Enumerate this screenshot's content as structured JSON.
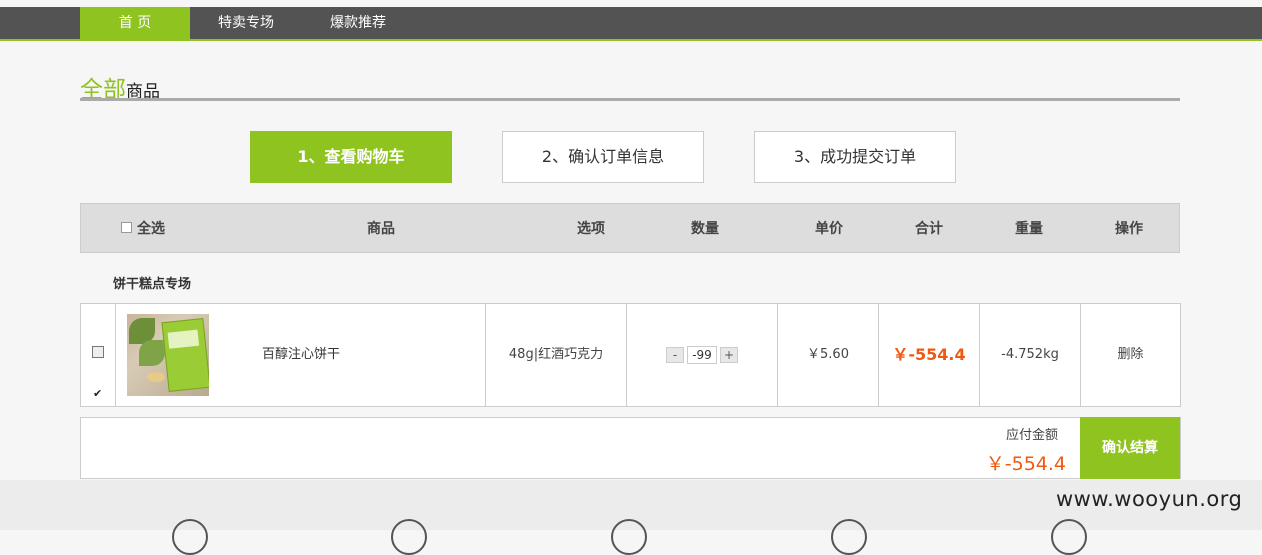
{
  "nav": {
    "items": [
      {
        "label": "首 页"
      },
      {
        "label": "特卖专场"
      },
      {
        "label": "爆款推荐"
      }
    ]
  },
  "section": {
    "title_highlight": "全部",
    "title_rest": "商品"
  },
  "steps": [
    {
      "label": "1、查看购物车",
      "active": true
    },
    {
      "label": "2、确认订单信息",
      "active": false
    },
    {
      "label": "3、成功提交订单",
      "active": false
    }
  ],
  "table": {
    "headers": {
      "select_all": "全选",
      "product": "商品",
      "option": "选项",
      "quantity": "数量",
      "unit_price": "单价",
      "total": "合计",
      "weight": "重量",
      "action": "操作"
    },
    "store_name": "饼干糕点专场",
    "rows": [
      {
        "checked": true,
        "product_name": "百醇注心饼干",
        "option": "48g|红酒巧克力",
        "qty_minus": "-",
        "quantity": "-99",
        "qty_plus": "+",
        "unit_price": "￥5.60",
        "total": "￥-554.4",
        "weight": "-4.752kg",
        "action": "删除"
      }
    ]
  },
  "summary": {
    "label": "应付金额",
    "amount": "￥-554.4",
    "checkout_label": "确认结算"
  },
  "watermark": "www.wooyun.org",
  "colors": {
    "accent": "#8fc31f",
    "price": "#ee5a12",
    "topbar": "#535353"
  }
}
